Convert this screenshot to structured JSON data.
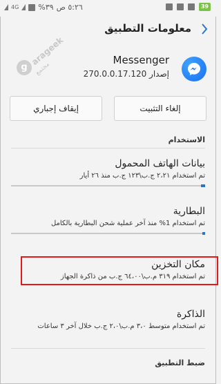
{
  "status_bar": {
    "time": "٥:٢٦ ص",
    "battery_percent": "٣٩%",
    "network": "4G",
    "carrier_badge": "39"
  },
  "header": {
    "title": "معلومات التطبيق",
    "back_icon": "chevron-right-icon"
  },
  "watermark": {
    "logo_letter": "g",
    "brand": "arageek",
    "sub": "مجتمع"
  },
  "app": {
    "name": "Messenger",
    "version": "إصدار 270.0.0.17.120",
    "icon": "messenger-icon",
    "icon_color": "#1a6ff0"
  },
  "buttons": {
    "uninstall": "إلغاء التثبيت",
    "force_stop": "إيقاف إجباري"
  },
  "usage_section": {
    "header": "الاستخدام",
    "items": [
      {
        "title": "بيانات الهاتف المحمول",
        "subtitle": "تم استخدام ٢،٢١ ج.ب\\١٢٣ ج.ب منذ ٢٦ أيار",
        "fill_fraction": 0.02
      },
      {
        "title": "البطارية",
        "subtitle": "تم استخدام 1% منذ آخر عملية شحن البطارية بالكامل",
        "fill_fraction": 0.01
      },
      {
        "title": "مكان التخزين",
        "subtitle": "تم استخدام ٣١٩ م.ب\\٦٤،٠٠ ج.ب من ذاكرة الجهاز"
      },
      {
        "title": "الذاكرة",
        "subtitle": "تم استخدام متوسط ٣،٠ م.ب\\٢،٠ ج.ب خلال آخر ٣ ساعات"
      }
    ]
  },
  "settings_section": {
    "header": "ضبط التطبيق"
  },
  "colors": {
    "accent": "#2a76c6",
    "highlight_border": "#e0191b"
  }
}
